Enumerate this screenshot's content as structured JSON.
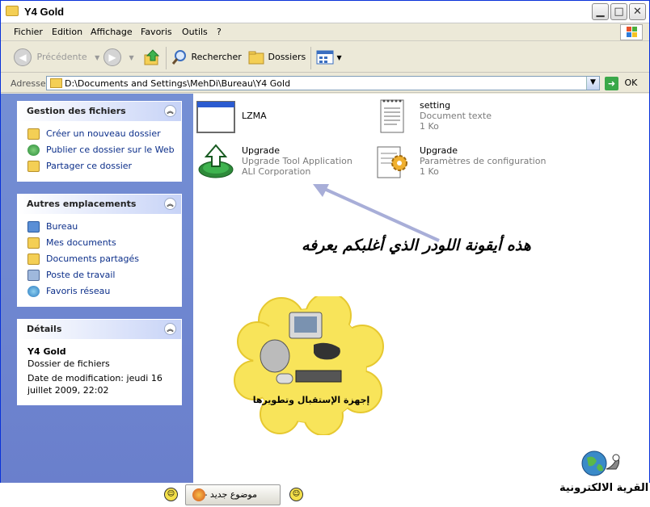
{
  "window": {
    "title": "Y4 Gold"
  },
  "window_controls": {
    "minimize": "▁",
    "maximize": "□",
    "close": "✕"
  },
  "menu": [
    "Fichier",
    "Edition",
    "Affichage",
    "Favoris",
    "Outils",
    "?"
  ],
  "toolbar": {
    "back_label": "Précédente",
    "search_label": "Rechercher",
    "folders_label": "Dossiers"
  },
  "address": {
    "label": "Adresse",
    "value": "D:\\Documents and Settings\\MehDi\\Bureau\\Y4 Gold",
    "go_label": "OK"
  },
  "tasks_panel": {
    "title": "Gestion des fichiers",
    "items": [
      "Créer un nouveau dossier",
      "Publier ce dossier sur le Web",
      "Partager ce dossier"
    ]
  },
  "places_panel": {
    "title": "Autres emplacements",
    "items": [
      "Bureau",
      "Mes documents",
      "Documents partagés",
      "Poste de travail",
      "Favoris réseau"
    ]
  },
  "details_panel": {
    "title": "Détails",
    "name": "Y4 Gold",
    "type": "Dossier de fichiers",
    "modified": "Date de modification: jeudi 16 juillet 2009, 22:02"
  },
  "files": [
    {
      "name": "LZMA",
      "line1": "",
      "line2": "",
      "icon": "application-window-icon"
    },
    {
      "name": "setting",
      "line1": "Document texte",
      "line2": "1 Ko",
      "icon": "text-document-icon"
    },
    {
      "name": "Upgrade",
      "line1": "Upgrade Tool Application",
      "line2": "ALI Corporation",
      "icon": "upgrade-tool-icon"
    },
    {
      "name": "Upgrade",
      "line1": "Paramètres de configuration",
      "line2": "1 Ko",
      "icon": "config-settings-icon"
    }
  ],
  "annotation": {
    "text": "هذه أيقونة اللودر الذي أغلبكم يعرفه"
  },
  "cloud_logo": {
    "text": "إجهزة الإستقبال وتطويرها"
  },
  "taskbar": {
    "button_label": "موضوع جديد -..."
  },
  "brand": {
    "text": "القرية الالكترونية"
  }
}
